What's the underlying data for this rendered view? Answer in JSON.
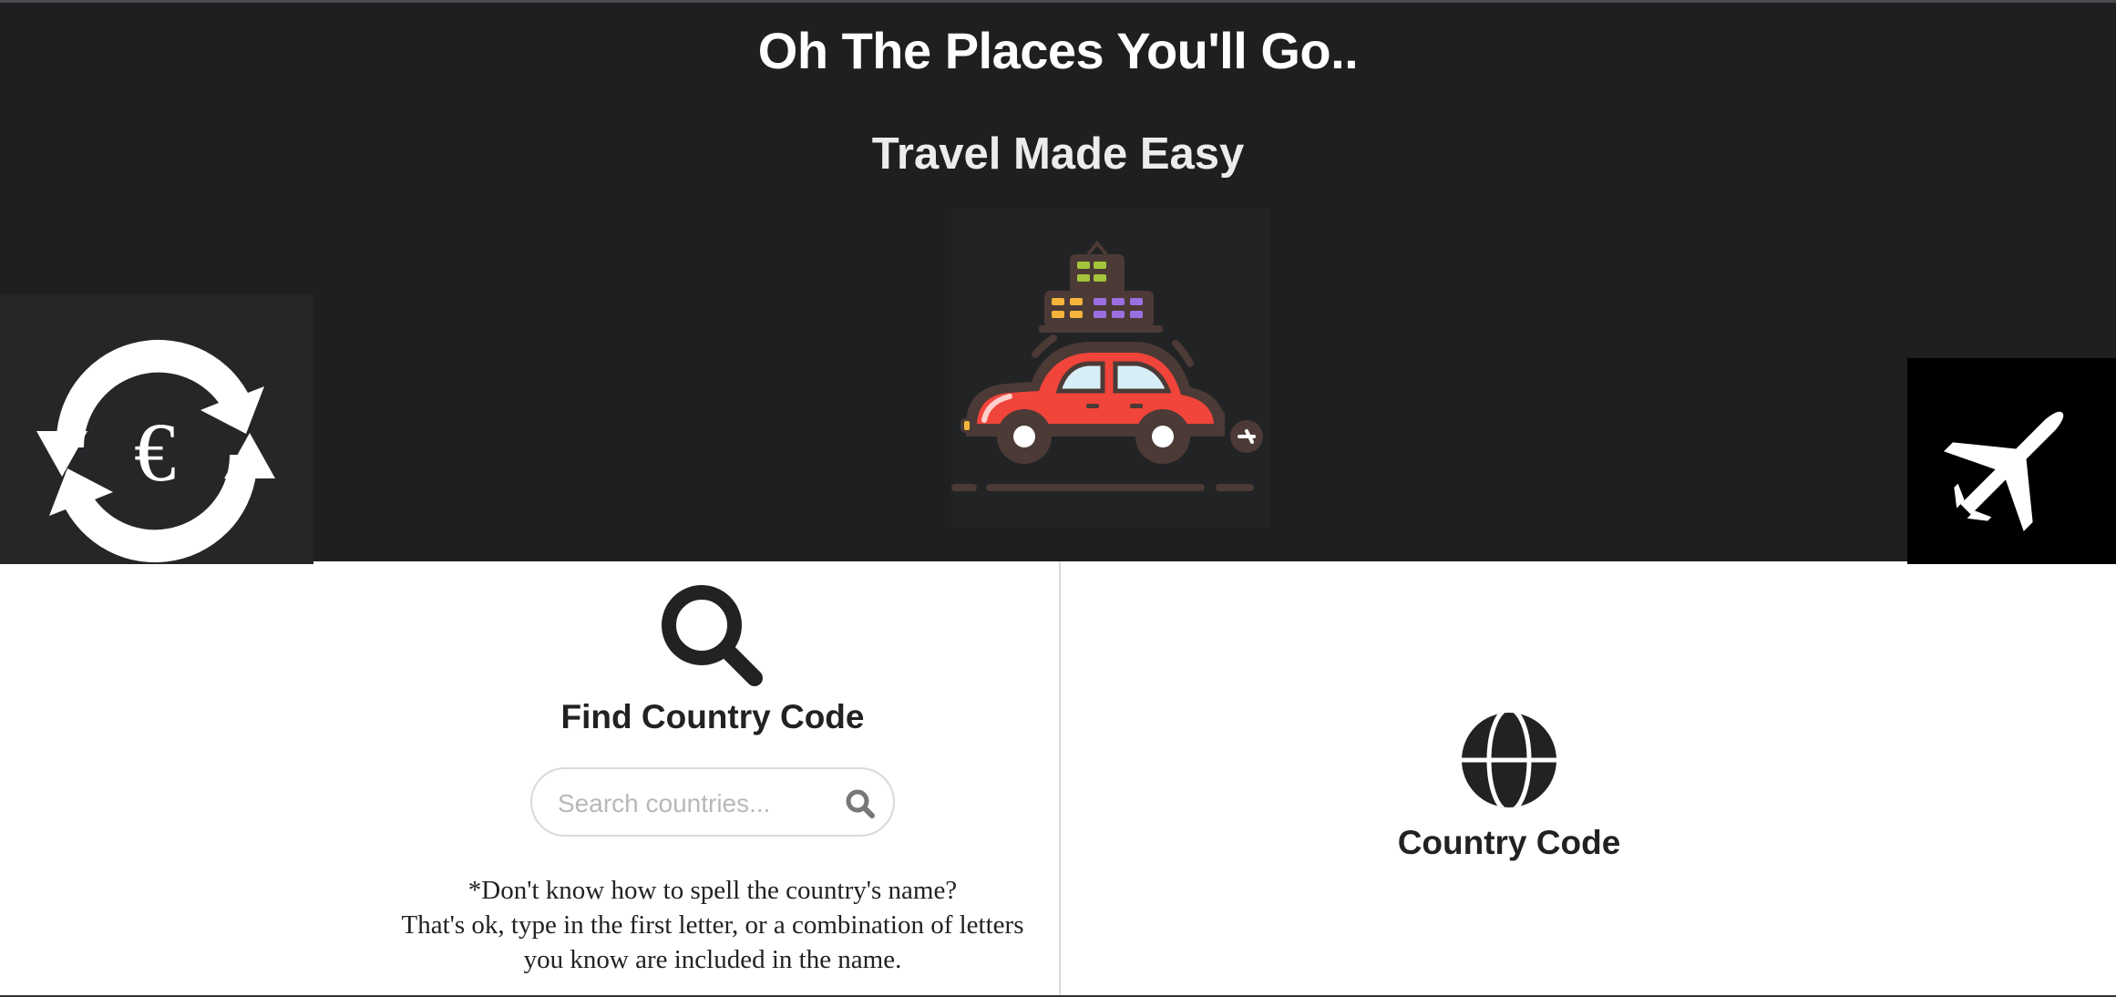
{
  "hero": {
    "title": "Oh The Places You'll Go..",
    "subtitle": "Travel Made Easy",
    "euro_tile": {
      "icon": "euro-exchange-icon",
      "symbol": "€"
    },
    "car_image": {
      "icon": "car-with-luggage-icon"
    },
    "plane_tile": {
      "icon": "airplane-icon"
    }
  },
  "find": {
    "icon": "search-icon",
    "title": "Find Country Code",
    "search": {
      "placeholder": "Search countries...",
      "value": "",
      "button_icon": "search-icon"
    },
    "help_lines": [
      "*Don't know how to spell the country's name?",
      "That's ok, type in the first letter, or a combination of letters",
      "you know are included in the name."
    ]
  },
  "result": {
    "icon": "globe-icon",
    "title": "Country Code"
  },
  "colors": {
    "hero_bg": "#1e1f21",
    "text_dark": "#222222",
    "car_red": "#f1443b",
    "car_dark": "#4b3a36"
  }
}
